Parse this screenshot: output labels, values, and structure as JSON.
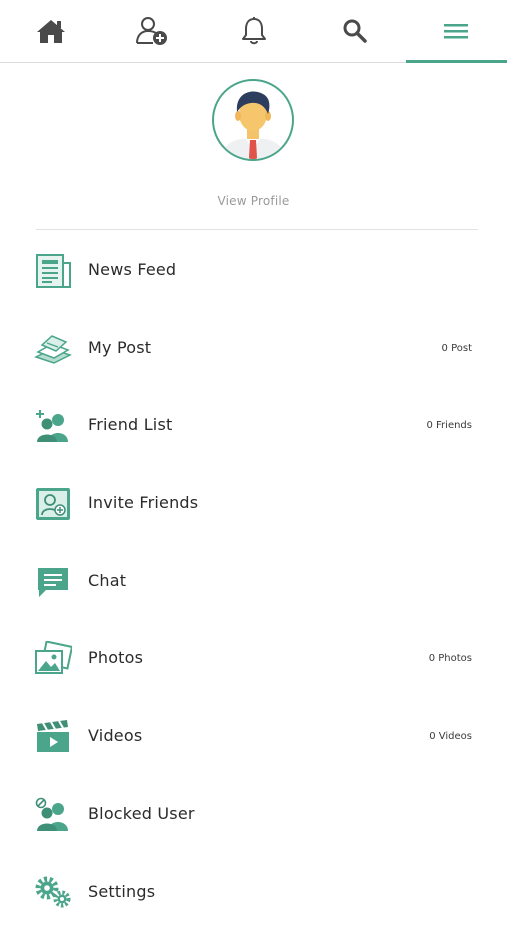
{
  "nav": {
    "tabs": [
      {
        "icon": "home-icon"
      },
      {
        "icon": "add-friend-icon"
      },
      {
        "icon": "bell-icon"
      },
      {
        "icon": "search-icon"
      },
      {
        "icon": "menu-icon",
        "active": true
      }
    ]
  },
  "profile": {
    "view_profile": "View Profile"
  },
  "menu": {
    "items": [
      {
        "label": "News Feed",
        "count": "",
        "icon": "newspaper-icon"
      },
      {
        "label": "My Post",
        "count": "0 Post",
        "icon": "posts-icon"
      },
      {
        "label": "Friend List",
        "count": "0 Friends",
        "icon": "friends-icon"
      },
      {
        "label": "Invite Friends",
        "count": "",
        "icon": "invite-icon"
      },
      {
        "label": "Chat",
        "count": "",
        "icon": "chat-icon"
      },
      {
        "label": "Photos",
        "count": "0 Photos",
        "icon": "photos-icon"
      },
      {
        "label": "Videos",
        "count": "0 Videos",
        "icon": "videos-icon"
      },
      {
        "label": "Blocked User",
        "count": "",
        "icon": "blocked-user-icon"
      },
      {
        "label": "Settings",
        "count": "",
        "icon": "settings-icon"
      }
    ]
  },
  "colors": {
    "accent": "#4aa58b",
    "icon_dark": "#3d3d3d"
  }
}
